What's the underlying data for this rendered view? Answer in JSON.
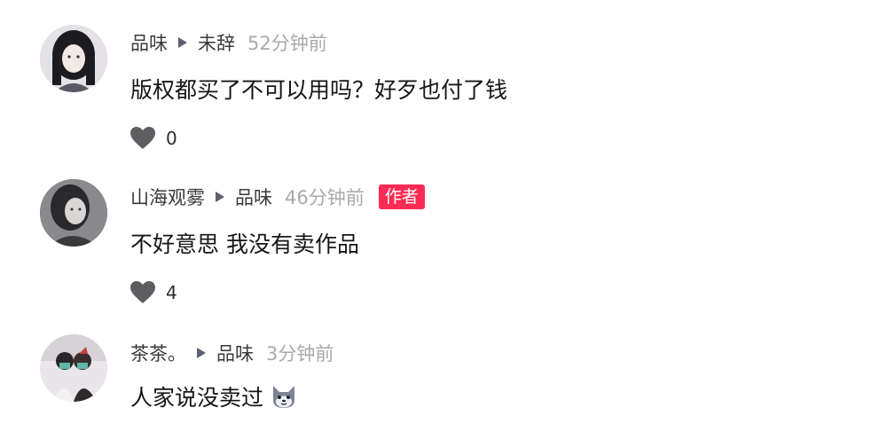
{
  "comments": [
    {
      "author": "品味",
      "reply_to": "未辞",
      "time": "52分钟前",
      "badge": "",
      "text": "版权都买了不可以用吗？好歹也付了钱",
      "likes": "0",
      "avatar_icon": "avatar-photo"
    },
    {
      "author": "山海观雾",
      "reply_to": "品味",
      "time": "46分钟前",
      "badge": "作者",
      "text": "不好意思 我没有卖作品",
      "likes": "4",
      "avatar_icon": "avatar-photo"
    },
    {
      "author": "茶茶。",
      "reply_to": "品味",
      "time": "3分钟前",
      "badge": "",
      "text": "人家说没卖过",
      "likes": "",
      "emoji": "cat-face-emoji",
      "avatar_icon": "avatar-photo"
    }
  ],
  "colors": {
    "author": "#3a3a3a",
    "time": "#a9a9ae",
    "badge_bg": "#fe2c55",
    "text": "#161616",
    "heart": "#5e5e60"
  }
}
